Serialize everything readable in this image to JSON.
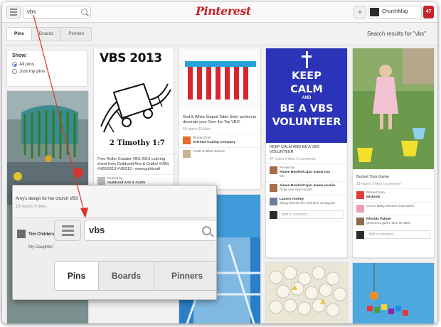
{
  "topbar": {
    "search_value": "vbs",
    "logo": "Pinterest",
    "user_name": "ChurchMag",
    "notifications": "47"
  },
  "subnav": {
    "tabs": [
      "Pins",
      "Boards",
      "Pinners"
    ],
    "active_tab": "Pins",
    "results_text": "Search results for \"vbs\""
  },
  "filter": {
    "heading": "Show:",
    "options": [
      "All pins",
      "Just my pins"
    ],
    "selected": "All pins"
  },
  "pins": {
    "vbs2013": {
      "image_title": "VBS 2013",
      "image_verse": "2 Timothy 1:7",
      "description": "Free Roller Coaster VBS 2013 coloring sheet from Guildcraft Arts & Crafts! #VBS #VBS2013 #VBS13 - www.guildcraft",
      "stats": "",
      "pinner_label": "Pinned by",
      "pinner_name": "Guildcraft Arts & Crafts",
      "pinner_board": "VBS Inspiration - Roller Coaster"
    },
    "table_skirt": {
      "description": "Red & White Striped Table Skirt- perfect to decorate your Over the Top VBS!",
      "stats": "59 repins   15 likes",
      "pinner_label": "Pinned from",
      "pinner_name": "Oriental Trading Company",
      "pinner_board": "Youth & Bible School"
    },
    "keep_calm": {
      "image_lines": [
        "KEEP",
        "CALM",
        "AND",
        "BE A VBS",
        "VOLUNTEER"
      ],
      "description": "KEEP CALM AND BE A VBS VOLUNTEER",
      "stats": "87 repins   8 likes   2 comments",
      "pinner_label": "Pinned by",
      "pinner_name": "Aimee Bowlin/Cajun mama coo",
      "pinner_board": "Me",
      "comments": [
        {
          "name": "Aimee Bowlin/Cajun mama cookin",
          "text": "I'll be one next month"
        },
        {
          "name": "Lauren Toohey",
          "text": "doing that for the 2nd time 24 days!!!"
        }
      ],
      "comment_placeholder": "Add a comment..."
    },
    "bucket_toss": {
      "description": "Bucket Toss Game",
      "stats": "19 repins   3 likes   1 comment",
      "pinner_label": "Pinned from",
      "pinner_name": "Mixbook",
      "pinner_board": "Circus Baby Shower Inspiration",
      "comment_name": "Rhonda Palmer",
      "comment_text": "preschool game time at VBS!",
      "comment_placeholder": "Add a comment..."
    },
    "amy": {
      "description": "Amy's design for her church VBS",
      "stats": "19 repins   6 likes",
      "pinner_name": "Tim Childers",
      "pinner_board": "My Daughter"
    }
  },
  "magnifier": {
    "search_value": "vbs",
    "tabs": [
      "Pins",
      "Boards",
      "Pinners"
    ],
    "active_tab": "Pins"
  },
  "colors": {
    "brand_red": "#c8232c",
    "keep_calm_blue": "#2b33b8",
    "arrow": "#d9342b"
  }
}
